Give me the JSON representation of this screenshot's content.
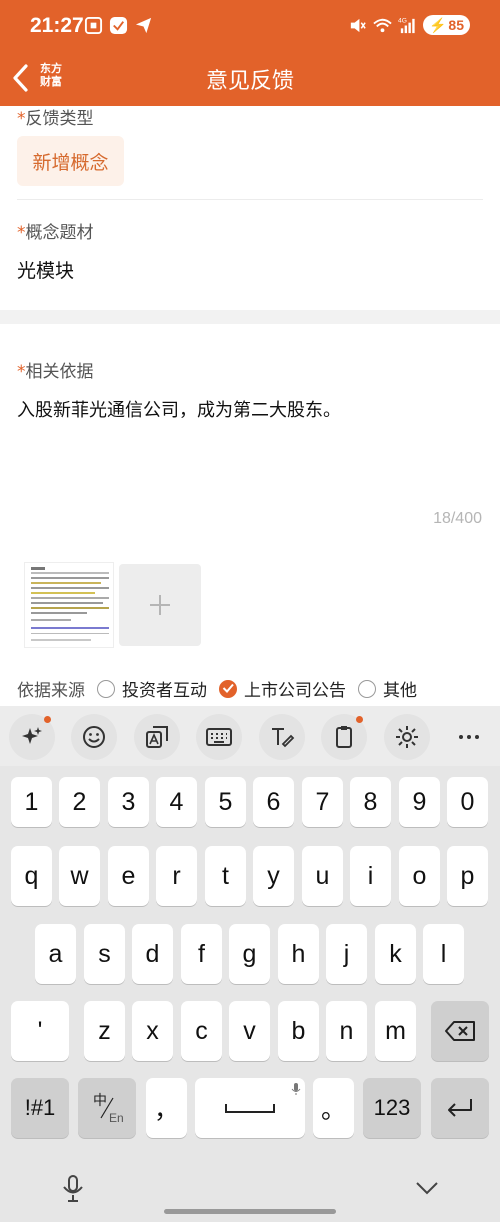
{
  "status": {
    "time": "21:27",
    "battery": "85",
    "net": "4G"
  },
  "nav": {
    "title": "意见反馈",
    "logo_line1": "东方",
    "logo_line2": "财富"
  },
  "form": {
    "type_label": "反馈类型",
    "type_value": "新增概念",
    "concept_label": "概念题材",
    "concept_value": "光模块",
    "basis_label": "相关依据",
    "basis_text": "入股新菲光通信公司，成为第二大股东。",
    "counter": "18/400",
    "source_label": "依据来源",
    "source_options": [
      {
        "label": "投资者互动",
        "checked": false
      },
      {
        "label": "上市公司公告",
        "checked": true
      },
      {
        "label": "其他",
        "checked": false
      }
    ],
    "required_mark": "*"
  },
  "keyboard": {
    "toolbar": [
      "sparkle-icon",
      "emoji-icon",
      "translate-icon",
      "keyboard-icon",
      "handwriting-icon",
      "clipboard-icon",
      "settings-icon",
      "more-icon"
    ],
    "row_num": [
      "1",
      "2",
      "3",
      "4",
      "5",
      "6",
      "7",
      "8",
      "9",
      "0"
    ],
    "row1": [
      "q",
      "w",
      "e",
      "r",
      "t",
      "y",
      "u",
      "i",
      "o",
      "p"
    ],
    "row2": [
      "a",
      "s",
      "d",
      "f",
      "g",
      "h",
      "j",
      "k",
      "l"
    ],
    "row3": [
      "'",
      "z",
      "x",
      "c",
      "v",
      "b",
      "n",
      "m"
    ],
    "sym": "!#1",
    "lang_top": "中",
    "lang_bottom": "En",
    "comma": "，",
    "period": "。",
    "num": "123"
  },
  "colors": {
    "accent": "#e2622a"
  }
}
